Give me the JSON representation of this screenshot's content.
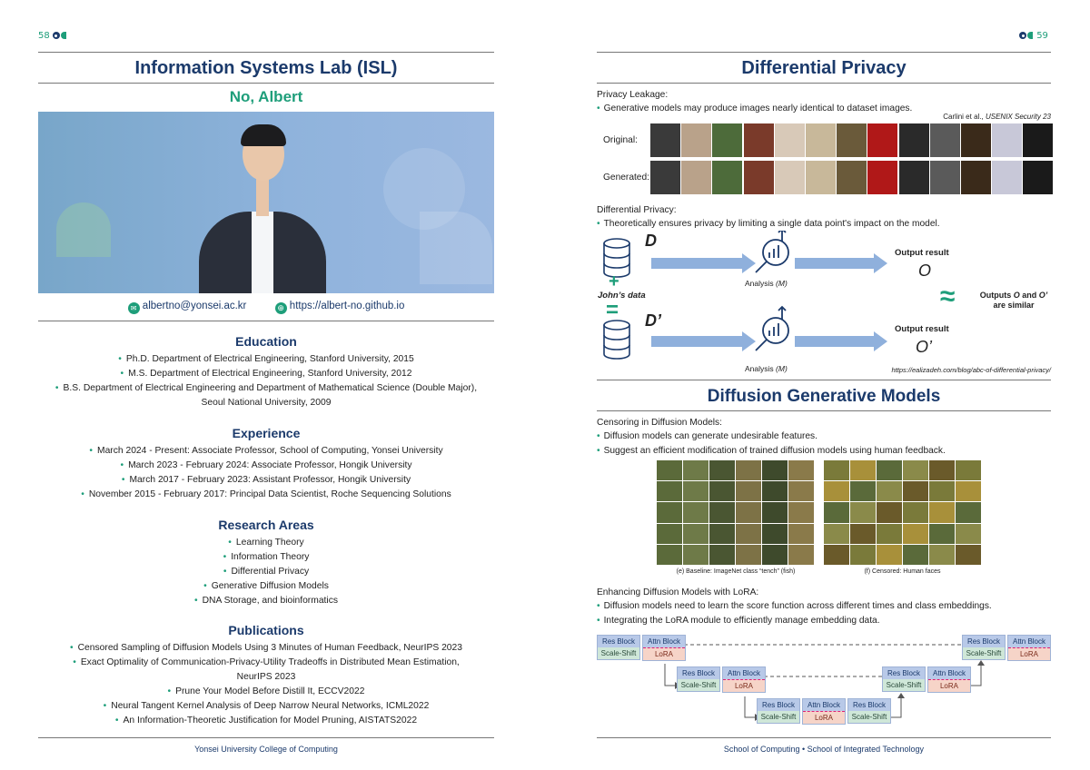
{
  "left": {
    "page_number": "58",
    "title": "Information Systems Lab (ISL)",
    "name": "No, Albert",
    "email": "albertno@yonsei.ac.kr",
    "website": "https://albert-no.github.io",
    "education": {
      "heading": "Education",
      "items": [
        "Ph.D. Department of Electrical Engineering, Stanford University, 2015",
        "M.S. Department of Electrical Engineering, Stanford University, 2012",
        "B.S. Department of Electrical Engineering and Department of Mathematical Science (Double Major),",
        "Seoul National University, 2009"
      ]
    },
    "experience": {
      "heading": "Experience",
      "items": [
        "March 2024 - Present: Associate Professor, School of Computing, Yonsei University",
        "March 2023 - February 2024: Associate Professor, Hongik University",
        "March 2017 - February 2023: Assistant Professor, Hongik University",
        "November 2015 - February 2017: Principal Data Scientist, Roche Sequencing Solutions"
      ]
    },
    "research": {
      "heading": "Research Areas",
      "items": [
        "Learning Theory",
        "Information Theory",
        "Differential Privacy",
        "Generative Diffusion Models",
        "DNA Storage, and bioinformatics"
      ]
    },
    "publications": {
      "heading": "Publications",
      "items": [
        "Censored Sampling of Diffusion Models Using 3 Minutes of Human Feedback, NeurIPS 2023",
        "Exact Optimality of Communication-Privacy-Utility Tradeoffs in Distributed Mean Estimation,",
        "NeurIPS 2023",
        "Prune Your Model Before Distill It, ECCV2022",
        "Neural Tangent Kernel Analysis of Deep Narrow Neural Networks, ICML2022",
        "An Information-Theoretic Justification for Model Pruning, AISTATS2022"
      ]
    },
    "footer": "Yonsei University College of Computing"
  },
  "right": {
    "page_number": "59",
    "title": "Differential Privacy",
    "leakage_heading": "Privacy Leakage:",
    "leakage_bullet": "Generative models may produce images nearly identical to dataset images.",
    "citation_prefix": "Carlini et al., ",
    "citation_venue": "USENIX Security 23",
    "row_original": "Original:",
    "row_generated": "Generated:",
    "dp_heading": "Differential Privacy:",
    "dp_bullet": "Theoretically ensures privacy by limiting a single data point's impact on the model.",
    "diagram": {
      "d": "D",
      "d_prime": "D’",
      "plus": "+",
      "equals": "=",
      "johns_data": "John’s data",
      "analysis": "Analysis",
      "analysis_m": "(M)",
      "output_result": "Output result",
      "o": "O",
      "o_prime": "O’",
      "approx": "≈",
      "similar_line1_pre": "Outputs ",
      "similar_o": "O",
      "similar_and": " and ",
      "similar_op": "O’",
      "similar_line2": "are similar",
      "url": "https://ealizadeh.com/blog/abc-of-differential-privacy/"
    },
    "diffusion_title": "Diffusion Generative Models",
    "censor_heading": "Censoring in Diffusion Models:",
    "censor_bullets": [
      "Diffusion models can generate undesirable features.",
      "Suggest an efficient modification of trained diffusion models using human feedback."
    ],
    "caption_e": "(e) Baseline: ImageNet class “tench” (fish)",
    "caption_f": "(f) Censored: Human faces",
    "lora_heading": "Enhancing Diffusion Models with LoRA:",
    "lora_bullets": [
      "Diffusion models need to learn the score function across different times and class embeddings.",
      "Integrating the LoRA module to efficiently manage embedding data."
    ],
    "blocks": {
      "res": "Res Block",
      "attn": "Attn Block",
      "scale": "Scale-Shift",
      "lora": "LoRA"
    },
    "footer": "School of Computing • School of Integrated Technology"
  },
  "colors": {
    "navy": "#1b3a6b",
    "green": "#1e9e7a",
    "photo_bg": "#7fa7d2",
    "arrow": "#8fb0dc"
  }
}
